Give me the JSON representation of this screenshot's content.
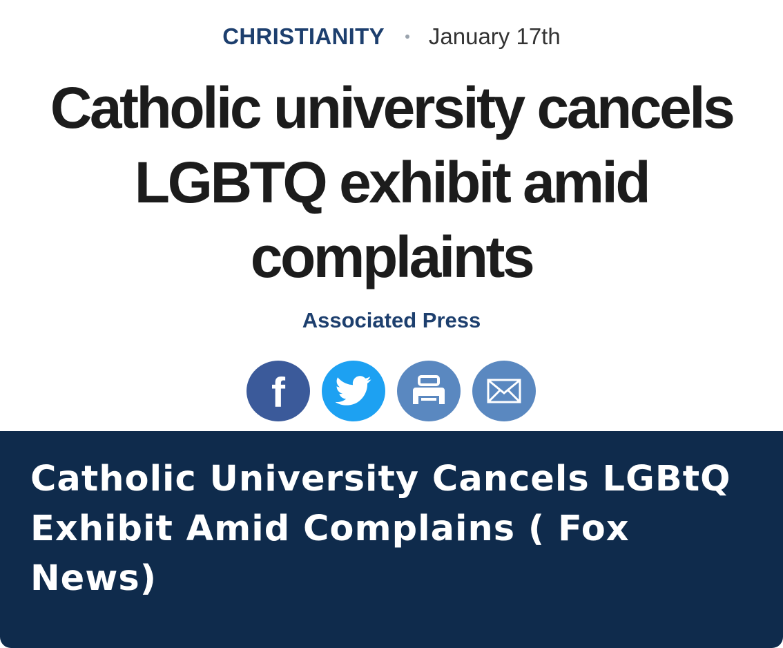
{
  "article": {
    "category": "CHRISTIANITY",
    "date": "January 17th",
    "headline": "Catholic university cancels LGBTQ exhibit amid complaints",
    "byline": "Associated Press"
  },
  "share": {
    "buttons": [
      {
        "icon": "facebook-icon",
        "color": "#3b5a9a",
        "glyph": "f"
      },
      {
        "icon": "twitter-icon",
        "color": "#1da1f2"
      },
      {
        "icon": "print-icon",
        "color": "#5a88c0"
      },
      {
        "icon": "email-icon",
        "color": "#5a88c0"
      }
    ]
  },
  "caption": {
    "text": "Catholic University Cancels LGBtQ Exhibit Amid Complains ( Fox News)",
    "background": "#0f2b4c"
  }
}
